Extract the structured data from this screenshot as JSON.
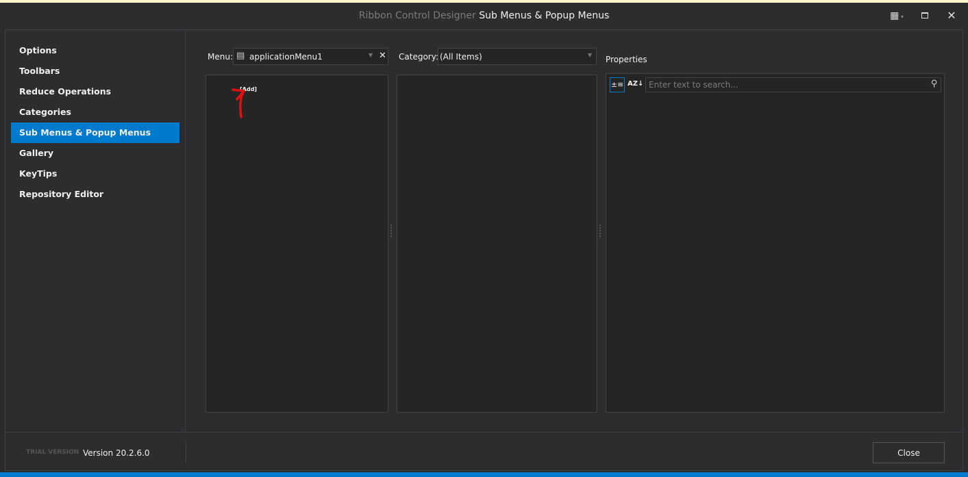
{
  "window": {
    "title_prefix": "Ribbon Control Designer",
    "title": "Sub Menus & Popup Menus",
    "buttons": [
      "layout-icon",
      "maximize-icon",
      "close-icon"
    ]
  },
  "nav": {
    "items": [
      {
        "label": "Options"
      },
      {
        "label": "Toolbars"
      },
      {
        "label": "Reduce Operations"
      },
      {
        "label": "Categories"
      },
      {
        "label": "Sub Menus & Popup Menus",
        "selected": true
      },
      {
        "label": "Gallery"
      },
      {
        "label": "KeyTips"
      },
      {
        "label": "Repository Editor"
      }
    ]
  },
  "menu": {
    "label": "Menu:",
    "value": "applicationMenu1",
    "tree_items": [
      "[Add]"
    ]
  },
  "category": {
    "label": "Category:",
    "value": "(All Items)"
  },
  "properties": {
    "title": "Properties",
    "search_placeholder": "Enter text to search..."
  },
  "footer": {
    "trial": "TRIAL VERSION",
    "version": "Version 20.2.6.0",
    "close_label": "Close"
  },
  "colors": {
    "accent": "#007acc",
    "background": "#2d2d30",
    "panel": "#252526",
    "annotation": "#e01010"
  }
}
